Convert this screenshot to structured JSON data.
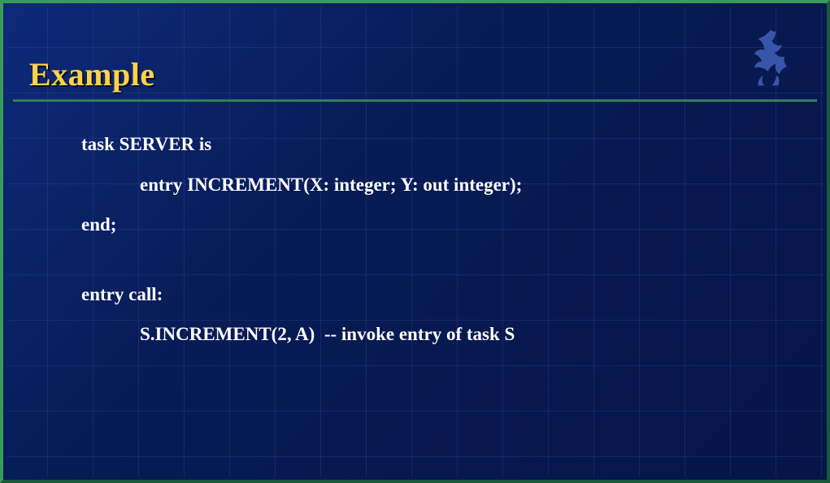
{
  "title": "Example",
  "code": {
    "l1": "task SERVER is",
    "l2": "entry INCREMENT(X: integer; Y: out integer);",
    "l3": "end;",
    "l4": "entry call:",
    "l5": "S.INCREMENT(2, A)  -- invoke entry of task S"
  },
  "logo_name": "griffin-logo"
}
